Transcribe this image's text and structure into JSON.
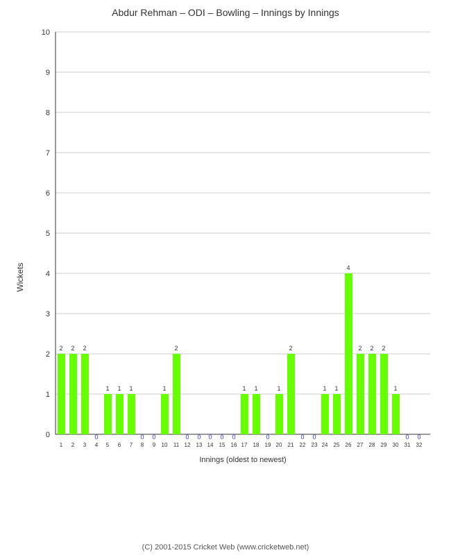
{
  "title": "Abdur Rehman – ODI – Bowling – Innings by Innings",
  "yAxisLabel": "Wickets",
  "xAxisLabel": "Innings (oldest to newest)",
  "copyright": "(C) 2001-2015 Cricket Web (www.cricketweb.net)",
  "yMax": 10,
  "yTicks": [
    0,
    1,
    2,
    3,
    4,
    5,
    6,
    7,
    8,
    9,
    10
  ],
  "bars": [
    {
      "inning": 1,
      "value": 2
    },
    {
      "inning": 2,
      "value": 2
    },
    {
      "inning": 3,
      "value": 2
    },
    {
      "inning": 4,
      "value": 0
    },
    {
      "inning": 5,
      "value": 1
    },
    {
      "inning": 6,
      "value": 1
    },
    {
      "inning": 7,
      "value": 1
    },
    {
      "inning": 8,
      "value": 0
    },
    {
      "inning": 9,
      "value": 0
    },
    {
      "inning": 10,
      "value": 1
    },
    {
      "inning": 11,
      "value": 2
    },
    {
      "inning": 12,
      "value": 0
    },
    {
      "inning": 13,
      "value": 0
    },
    {
      "inning": 14,
      "value": 0
    },
    {
      "inning": 15,
      "value": 0
    },
    {
      "inning": 16,
      "value": 0
    },
    {
      "inning": 17,
      "value": 1
    },
    {
      "inning": 18,
      "value": 1
    },
    {
      "inning": 19,
      "value": 0
    },
    {
      "inning": 20,
      "value": 1
    },
    {
      "inning": 21,
      "value": 2
    },
    {
      "inning": 22,
      "value": 0
    },
    {
      "inning": 23,
      "value": 0
    },
    {
      "inning": 24,
      "value": 1
    },
    {
      "inning": 25,
      "value": 1
    },
    {
      "inning": 26,
      "value": 4
    },
    {
      "inning": 27,
      "value": 2
    },
    {
      "inning": 28,
      "value": 2
    },
    {
      "inning": 29,
      "value": 2
    },
    {
      "inning": 30,
      "value": 1
    },
    {
      "inning": 31,
      "value": 0
    },
    {
      "inning": 32,
      "value": 0
    }
  ]
}
